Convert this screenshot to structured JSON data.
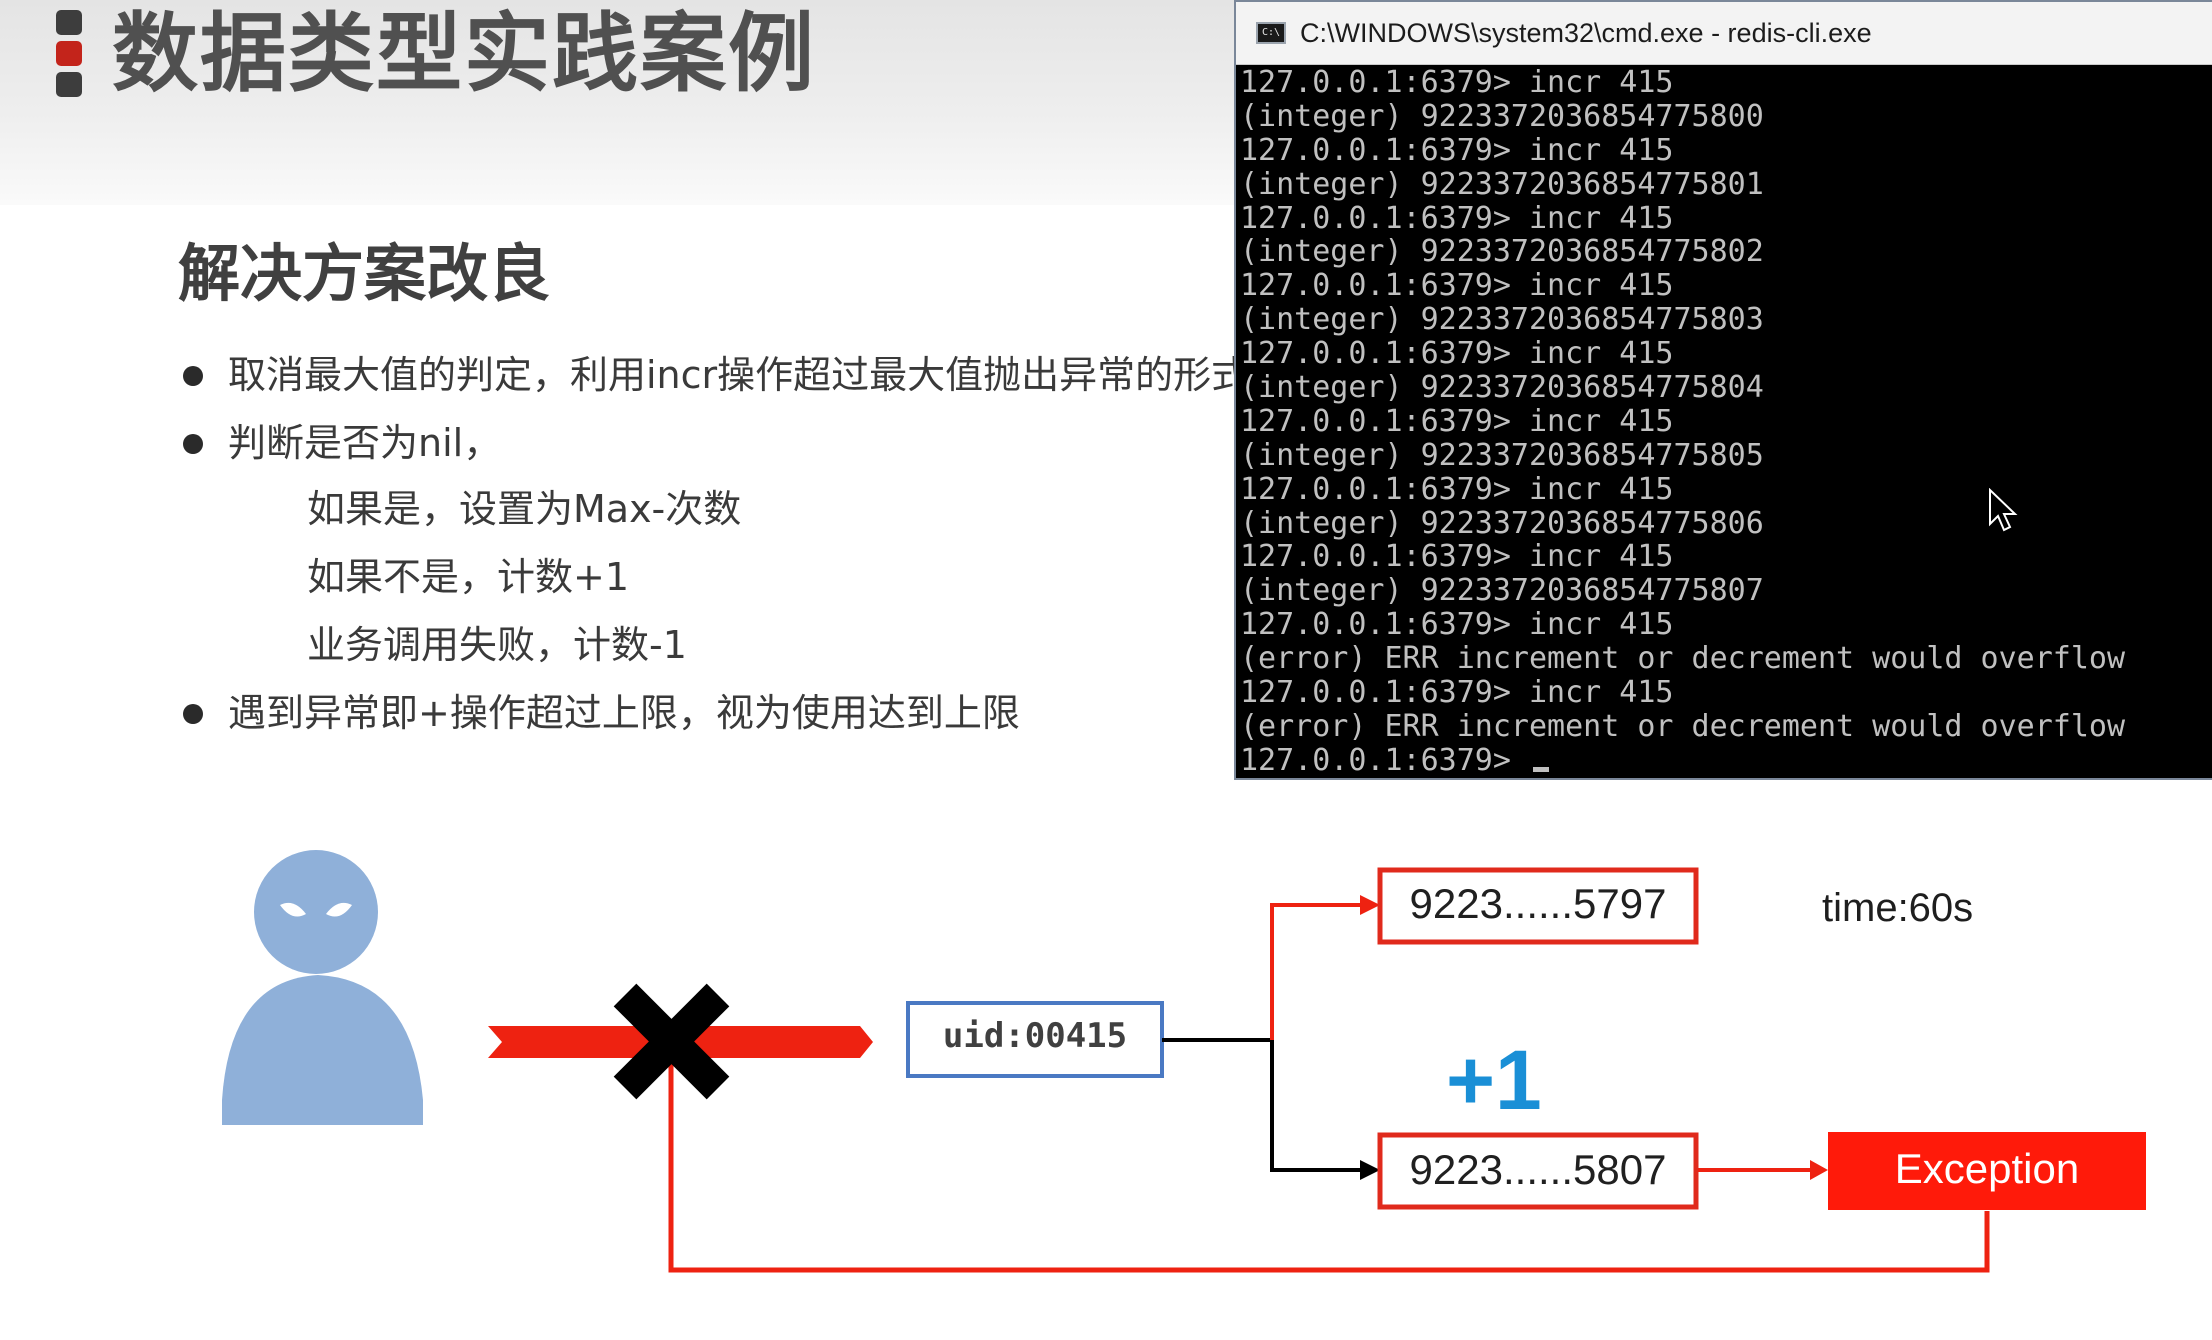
{
  "slide": {
    "title": "数据类型实践案例",
    "section_heading": "解决方案改良",
    "bullets": [
      "取消最大值的判定，利用incr操作超过最大值抛出异常的形式",
      "判断是否为nil，",
      "遇到异常即+操作超过上限，视为使用达到上限"
    ],
    "sub_items": [
      "如果是，设置为Max-次数",
      "如果不是，计数+1",
      "业务调用失败，计数-1"
    ]
  },
  "terminal": {
    "title": "C:\\WINDOWS\\system32\\cmd.exe - redis-cli.exe",
    "icon_label": "C:\\",
    "lines": [
      "127.0.0.1:6379> incr 415",
      "(integer) 9223372036854775800",
      "127.0.0.1:6379> incr 415",
      "(integer) 9223372036854775801",
      "127.0.0.1:6379> incr 415",
      "(integer) 9223372036854775802",
      "127.0.0.1:6379> incr 415",
      "(integer) 9223372036854775803",
      "127.0.0.1:6379> incr 415",
      "(integer) 9223372036854775804",
      "127.0.0.1:6379> incr 415",
      "(integer) 9223372036854775805",
      "127.0.0.1:6379> incr 415",
      "(integer) 9223372036854775806",
      "127.0.0.1:6379> incr 415",
      "(integer) 9223372036854775807",
      "127.0.0.1:6379> incr 415",
      "(error) ERR increment or decrement would overflow",
      "127.0.0.1:6379> incr 415",
      "(error) ERR increment or decrement would overflow"
    ],
    "prompt": "127.0.0.1:6379> "
  },
  "diagram": {
    "uid_label": "uid:00415",
    "top_value": "9223......5797",
    "bottom_value": "9223......5807",
    "time_label": "time:60s",
    "plus_label": "+1",
    "exception_label": "Exception",
    "colors": {
      "arrow_red": "#ee2211",
      "box_red": "#e02a1c",
      "exception_fill": "#ff1a0a",
      "uid_border": "#4a79c3",
      "user_figure": "#8fb0d9",
      "plus_blue": "#1a8fd6"
    },
    "icons": [
      "user-figure-icon",
      "blocked-cross-icon",
      "mouse-pointer-icon"
    ]
  }
}
